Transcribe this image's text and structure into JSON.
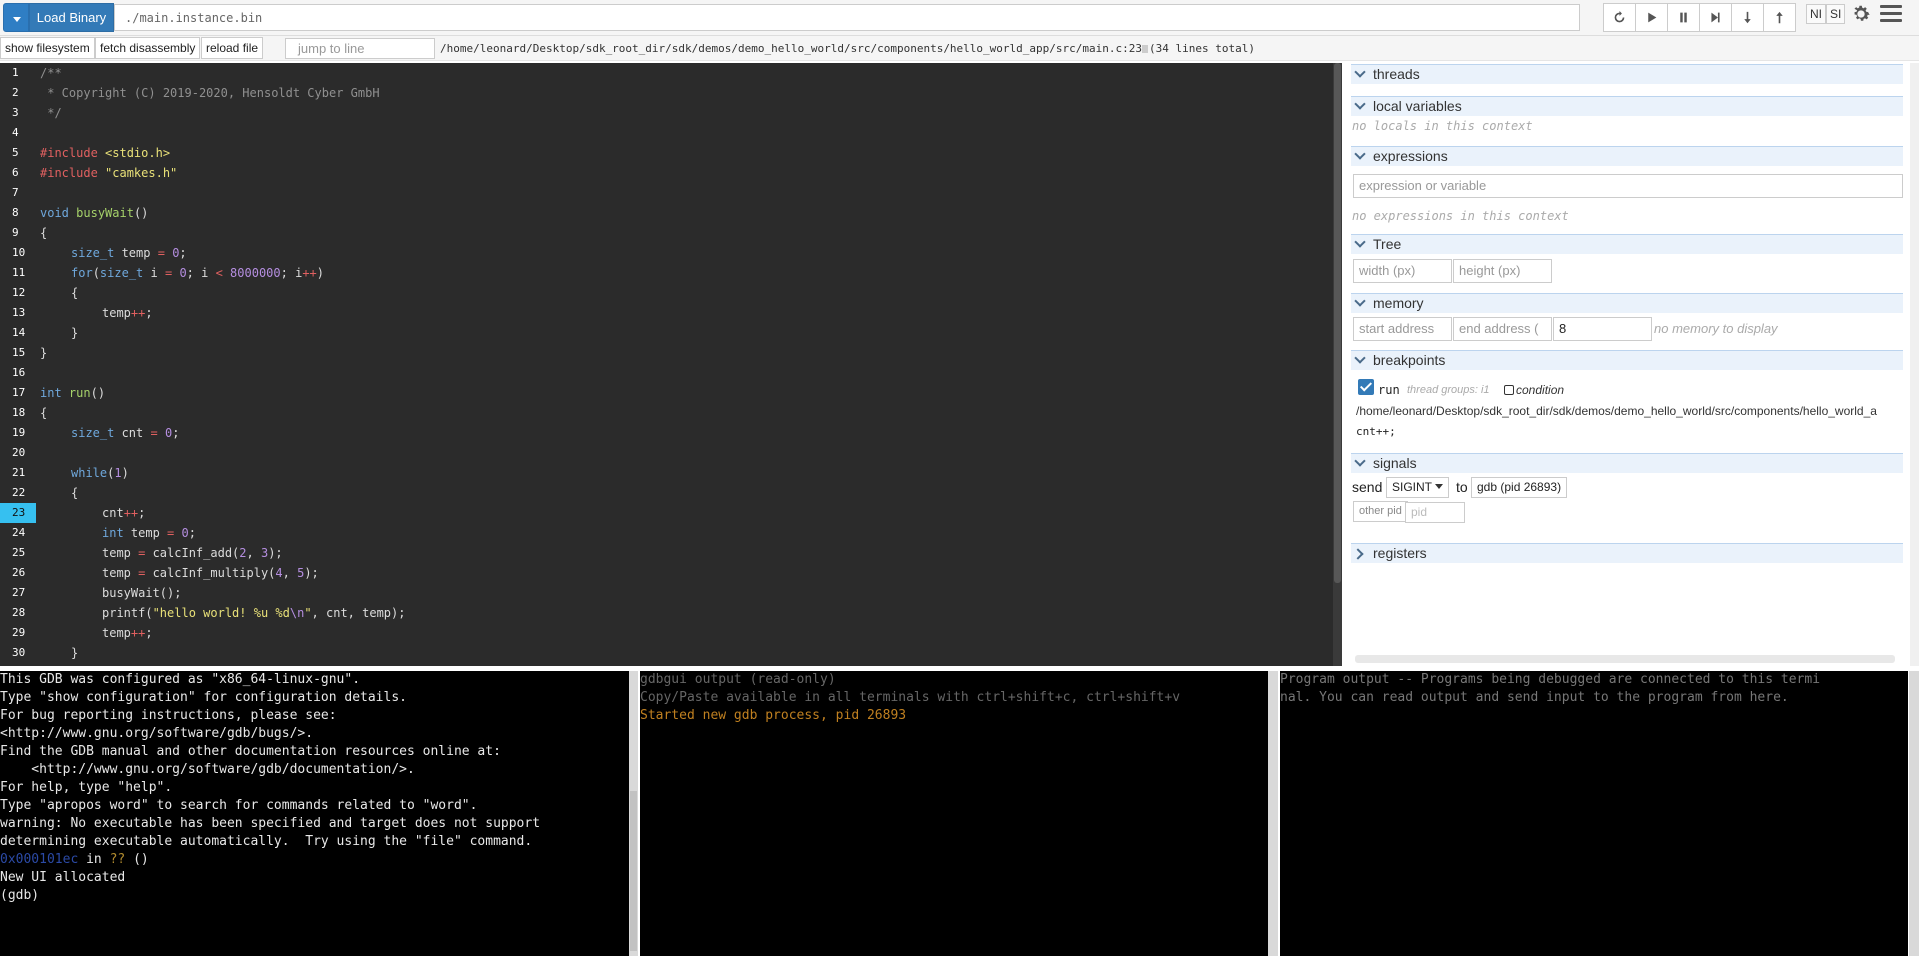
{
  "toolbar": {
    "load_binary_label": "Load Binary",
    "binary_path": "./main.instance.bin",
    "ni_label": "NI",
    "si_label": "SI"
  },
  "secondbar": {
    "show_filesystem": "show filesystem",
    "fetch_disassembly": "fetch disassembly",
    "reload_file": "reload file",
    "jump_placeholder": "jump to line",
    "file_path": "/home/leonard/Desktop/sdk_root_dir/sdk/demos/demo_hello_world/src/components/hello_world_app/src/main.c:23",
    "line_count": "(34 lines total)"
  },
  "code": {
    "highlight_line": 23,
    "lines": [
      {
        "n": "1"
      },
      {
        "n": "2"
      },
      {
        "n": "3"
      },
      {
        "n": "4"
      },
      {
        "n": "5"
      },
      {
        "n": "6"
      },
      {
        "n": "7"
      },
      {
        "n": "8"
      },
      {
        "n": "9"
      },
      {
        "n": "10"
      },
      {
        "n": "11"
      },
      {
        "n": "12"
      },
      {
        "n": "13"
      },
      {
        "n": "14"
      },
      {
        "n": "15"
      },
      {
        "n": "16"
      },
      {
        "n": "17"
      },
      {
        "n": "18"
      },
      {
        "n": "19"
      },
      {
        "n": "20"
      },
      {
        "n": "21"
      },
      {
        "n": "22"
      },
      {
        "n": "23"
      },
      {
        "n": "24"
      },
      {
        "n": "25"
      },
      {
        "n": "26"
      },
      {
        "n": "27"
      },
      {
        "n": "28"
      },
      {
        "n": "29"
      },
      {
        "n": "30"
      }
    ],
    "text": {
      "l1": "/**",
      "l2": " * Copyright (C) 2019-2020, Hensoldt Cyber GmbH",
      "l3": " */",
      "l5_pp": "#include",
      "l5_str": "<stdio.h>",
      "l6_pp": "#include",
      "l6_str": "\"camkes.h\"",
      "l8_kw": "void",
      "l8_fn": "busyWait",
      "l8_rest": "()",
      "l9": "{",
      "l10_kw": "size_t",
      "l10_a": " temp ",
      "l10_op": "=",
      "l10_sp": " ",
      "l10_nm": "0",
      "l10_end": ";",
      "l11_kw1": "for",
      "l11_a": "(",
      "l11_kw2": "size_t",
      "l11_b": " i ",
      "l11_op1": "=",
      "l11_sp1": " ",
      "l11_nm1": "0",
      "l11_c": "; i ",
      "l11_op2": "<",
      "l11_sp2": " ",
      "l11_nm2": "8000000",
      "l11_d": "; i",
      "l11_op3": "++",
      "l11_e": ")",
      "l12": "{",
      "l13_a": "temp",
      "l13_op": "++",
      "l13_end": ";",
      "l14": "}",
      "l15": "}",
      "l17_kw": "int",
      "l17_fn": "run",
      "l17_rest": "()",
      "l18": "{",
      "l19_kw": "size_t",
      "l19_a": " cnt ",
      "l19_op": "=",
      "l19_sp": " ",
      "l19_nm": "0",
      "l19_end": ";",
      "l21_kw": "while",
      "l21_a": "(",
      "l21_nm": "1",
      "l21_b": ")",
      "l22": "{",
      "l23_a": "cnt",
      "l23_op": "++",
      "l23_end": ";",
      "l24_kw": "int",
      "l24_a": " temp ",
      "l24_op": "=",
      "l24_sp": " ",
      "l24_nm": "0",
      "l24_end": ";",
      "l25_a": "temp ",
      "l25_op": "=",
      "l25_b": " calcInf_add(",
      "l25_nm1": "2",
      "l25_c": ", ",
      "l25_nm2": "3",
      "l25_d": ");",
      "l26_a": "temp ",
      "l26_op": "=",
      "l26_b": " calcInf_multiply(",
      "l26_nm1": "4",
      "l26_c": ", ",
      "l26_nm2": "5",
      "l26_d": ");",
      "l27": "busyWait();",
      "l28_a": "printf(",
      "l28_str1": "\"hello world! %u %d",
      "l28_esc": "\\n",
      "l28_str2": "\"",
      "l28_b": ", cnt, temp);",
      "l29_a": "temp",
      "l29_op": "++",
      "l29_end": ";",
      "l30": "}"
    }
  },
  "panel": {
    "threads": "threads",
    "local_variables": "local variables",
    "no_locals": "no locals in this context",
    "expressions": "expressions",
    "expression_placeholder": "expression or variable",
    "no_expressions": "no expressions in this context",
    "tree": "Tree",
    "width_placeholder": "width (px)",
    "height_placeholder": "height (px)",
    "memory": "memory",
    "start_address_placeholder": "start address",
    "end_address_placeholder": "end address (",
    "bytes_value": "8",
    "no_memory": "no memory to display",
    "breakpoints": "breakpoints",
    "bp_function": "run",
    "bp_thread_groups": "thread groups: i1",
    "bp_condition": "condition",
    "bp_file": "/home/leonard/Desktop/sdk_root_dir/sdk/demos/demo_hello_world/src/components/hello_world_a",
    "bp_code": "cnt++;",
    "signals": "signals",
    "send_label": "send",
    "signal_value": "SIGINT",
    "to_label": "to",
    "gdb_pid_label": "gdb (pid 26893)",
    "other_pid_label": "other pid",
    "pid_placeholder": "pid",
    "registers": "registers"
  },
  "terminals": {
    "gdb": [
      "This GDB was configured as \"x86_64-linux-gnu\".",
      "Type \"show configuration\" for configuration details.",
      "For bug reporting instructions, please see:",
      "<http://www.gnu.org/software/gdb/bugs/>.",
      "Find the GDB manual and other documentation resources online at:",
      "    <http://www.gnu.org/software/gdb/documentation/>.",
      "",
      "For help, type \"help\".",
      "Type \"apropos word\" to search for commands related to \"word\".",
      "",
      "warning: No executable has been specified and target does not support",
      "determining executable automatically.  Try using the \"file\" command.",
      "",
      "New UI allocated",
      "(gdb)"
    ],
    "gdb_addr": "0x000101ec",
    "gdb_addr_in": " in ",
    "gdb_addr_qq": "??",
    "gdb_addr_rest": " ()",
    "gdbgui_line1": "gdbgui output (read-only)",
    "gdbgui_line2": "Copy/Paste available in all terminals with ctrl+shift+c, ctrl+shift+v",
    "gdbgui_line3": "Started new gdb process, pid 26893",
    "program_line1": "Program output -- Programs being debugged are connected to this termi",
    "program_line2": "nal. You can read output and send input to the program from here."
  },
  "colors": {
    "accent": "#337ab7",
    "highlight_line": "#36c0f0",
    "section_header": "#eaf2fb",
    "gdbgui_gray": "#666666",
    "gdbgui_orange": "#c08020"
  }
}
